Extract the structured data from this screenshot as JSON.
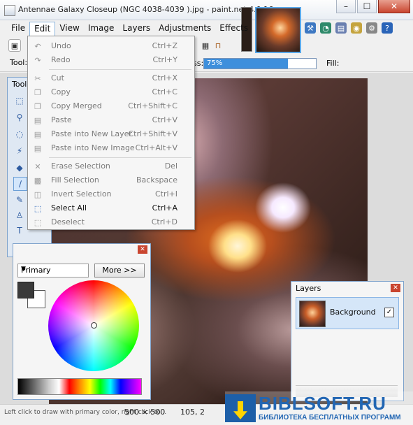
{
  "window": {
    "title": "Antennae Galaxy Closeup (NGC 4038-4039 ).jpg - paint.net 4.0.16",
    "controls": {
      "minimize": "–",
      "maximize": "☐",
      "close": "✕"
    }
  },
  "menubar": [
    {
      "label": "File"
    },
    {
      "label": "Edit"
    },
    {
      "label": "View"
    },
    {
      "label": "Image"
    },
    {
      "label": "Layers"
    },
    {
      "label": "Adjustments"
    },
    {
      "label": "Effects"
    }
  ],
  "toolbar": {
    "tool_label": "Tool:",
    "opacity_label": "ss:",
    "opacity_value": "75%",
    "opacity_fraction": 0.75,
    "fill_label": "Fill:"
  },
  "edit_menu": {
    "items": [
      {
        "label": "Undo",
        "shortcut": "Ctrl+Z",
        "icon": "undo-icon",
        "enabled": false
      },
      {
        "label": "Redo",
        "shortcut": "Ctrl+Y",
        "icon": "redo-icon",
        "enabled": false
      },
      {
        "label": "Cut",
        "shortcut": "Ctrl+X",
        "icon": "cut-icon",
        "enabled": false
      },
      {
        "label": "Copy",
        "shortcut": "Ctrl+C",
        "icon": "copy-icon",
        "enabled": false
      },
      {
        "label": "Copy Merged",
        "shortcut": "Ctrl+Shift+C",
        "icon": "copy-merged-icon",
        "enabled": false
      },
      {
        "label": "Paste",
        "shortcut": "Ctrl+V",
        "icon": "paste-icon",
        "enabled": false
      },
      {
        "label": "Paste into New Layer",
        "shortcut": "Ctrl+Shift+V",
        "icon": "paste-layer-icon",
        "enabled": false
      },
      {
        "label": "Paste into New Image",
        "shortcut": "Ctrl+Alt+V",
        "icon": "paste-image-icon",
        "enabled": false
      },
      {
        "label": "Erase Selection",
        "shortcut": "Del",
        "icon": "erase-icon",
        "enabled": false
      },
      {
        "label": "Fill Selection",
        "shortcut": "Backspace",
        "icon": "fill-icon",
        "enabled": false
      },
      {
        "label": "Invert Selection",
        "shortcut": "Ctrl+I",
        "icon": "invert-icon",
        "enabled": false
      },
      {
        "label": "Select All",
        "shortcut": "Ctrl+A",
        "icon": "select-all-icon",
        "enabled": true
      },
      {
        "label": "Deselect",
        "shortcut": "Ctrl+D",
        "icon": "deselect-icon",
        "enabled": false
      }
    ]
  },
  "tools_panel": {
    "title": "Tools"
  },
  "colors_panel": {
    "primary_select": "Primary",
    "more_button": "More >>"
  },
  "layers_panel": {
    "title": "Layers",
    "layers": [
      {
        "name": "Background",
        "visible_mark": "✓"
      }
    ]
  },
  "statusbar": {
    "hint": "Left click to draw with primary color, right click to...",
    "image_size": "500 × 500",
    "cursor_pos": "105, 2"
  },
  "watermark": {
    "title": "BIBLSOFT.RU",
    "subtitle": "БИБЛИОТЕКА БЕСПЛАТНЫХ ПРОГРАММ"
  }
}
